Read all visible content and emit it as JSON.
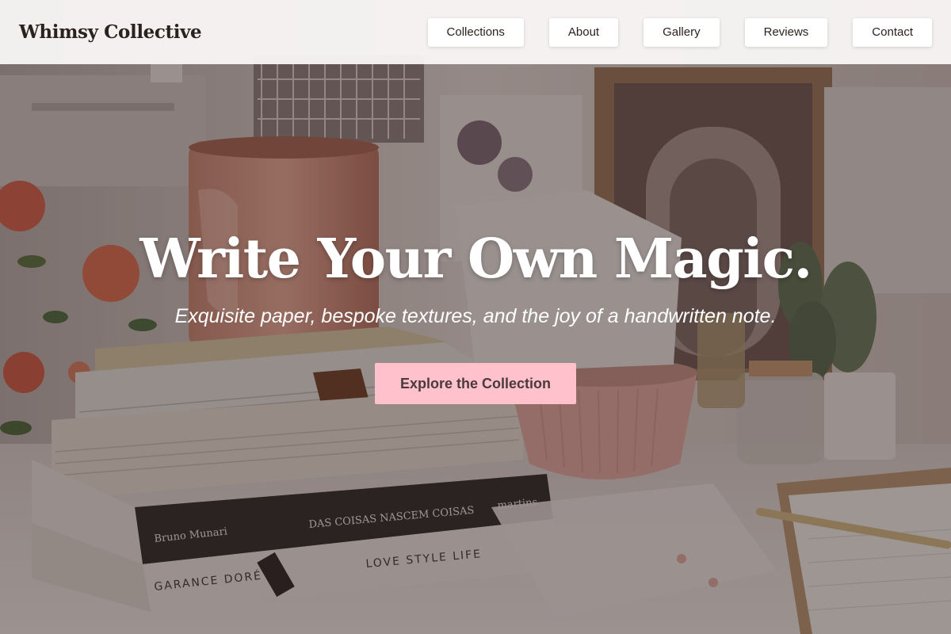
{
  "header": {
    "brand": "Whimsy Collective",
    "nav": [
      {
        "label": "Collections"
      },
      {
        "label": "About"
      },
      {
        "label": "Gallery"
      },
      {
        "label": "Reviews"
      },
      {
        "label": "Contact"
      }
    ]
  },
  "hero": {
    "title": "Write Your Own Magic.",
    "subtitle": "Exquisite paper, bespoke textures, and the joy of a handwritten note.",
    "cta_label": "Explore the Collection",
    "background_image": "desk-with-books-mug-flowers-cactus",
    "book_spines": [
      "Bruno Munari",
      "DAS COISAS NASCEM COISAS",
      "martins",
      "LOVE   STYLE   LIFE",
      "GARANCE DORÉ"
    ]
  },
  "colors": {
    "header_bg": "#faf8f7",
    "brand_text": "#2b2220",
    "hero_text": "#ffffff",
    "cta_bg": "#ffc2cc",
    "cta_text": "#4a3a3a"
  }
}
